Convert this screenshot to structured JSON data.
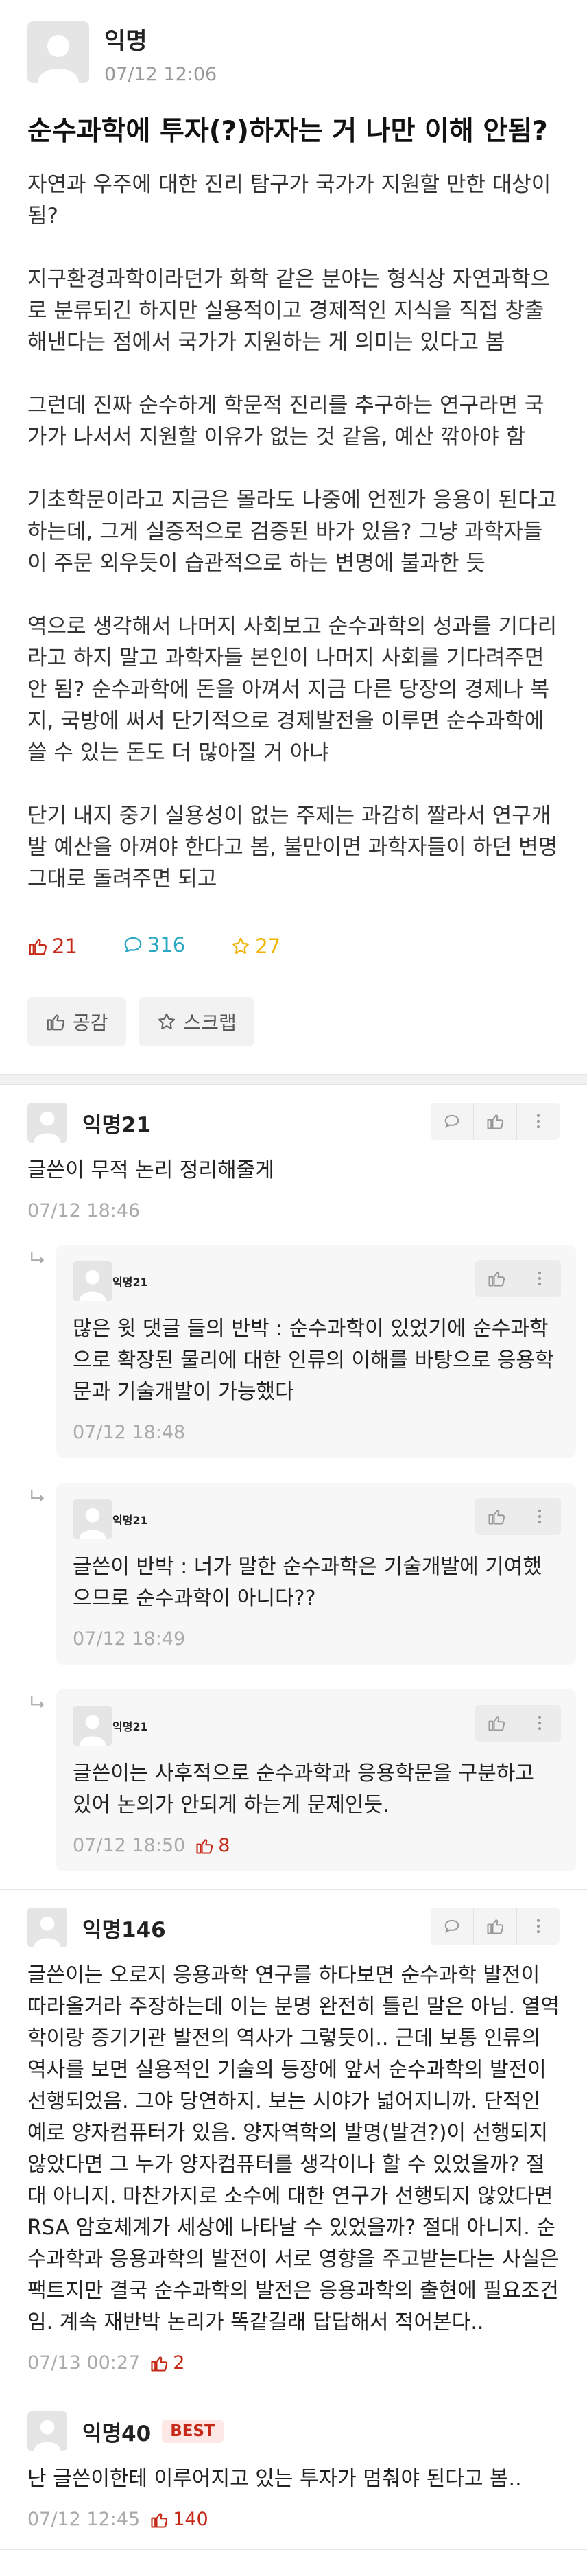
{
  "post": {
    "author": "익명",
    "time": "07/12 12:06",
    "title": "순수과학에 투자(?)하자는 거 나만 이해 안됨?",
    "paragraphs": [
      "자연과 우주에 대한 진리 탐구가 국가가 지원할 만한 대상이 됨?",
      "지구환경과학이라던가 화학 같은 분야는 형식상 자연과학으로 분류되긴 하지만 실용적이고 경제적인 지식을 직접 창출해낸다는 점에서 국가가 지원하는 게 의미는 있다고 봄",
      "그런데 진짜 순수하게 학문적 진리를 추구하는 연구라면 국가가 나서서 지원할 이유가 없는 것 같음, 예산 깎아야 함",
      "기초학문이라고 지금은 몰라도 나중에 언젠가 응용이 된다고 하는데, 그게 실증적으로 검증된 바가 있음? 그냥 과학자들이 주문 외우듯이 습관적으로 하는 변명에 불과한 듯",
      "역으로 생각해서 나머지 사회보고 순수과학의 성과를 기다리라고 하지 말고 과학자들 본인이 나머지 사회를 기다려주면 안 됨? 순수과학에 돈을 아껴서 지금 다른 당장의 경제나 복지, 국방에 써서 단기적으로 경제발전을 이루면 순수과학에 쓸 수 있는 돈도 더 많아질 거 아냐",
      "단기 내지 중기 실용성이 없는 주제는 과감히 짤라서 연구개발 예산을 아껴야 한다고 봄, 불만이면 과학자들이 하던 변명 그대로 돌려주면 되고"
    ],
    "likes": "21",
    "comments": "316",
    "scraps": "27",
    "like_button": "공감",
    "scrap_button": "스크랩"
  },
  "comments": [
    {
      "author": "익명21",
      "text": "글쓴이 무적 논리 정리해줄게",
      "time": "07/12 18:46",
      "likes": "",
      "replies": [
        {
          "author": "익명21",
          "text": "많은 윗 댓글 들의 반박 : 순수과학이 있었기에 순수과학으로 확장된 물리에 대한 인류의 이해를 바탕으로 응용학문과 기술개발이 가능했다",
          "time": "07/12 18:48",
          "likes": ""
        },
        {
          "author": "익명21",
          "text": "글쓴이 반박 : 너가 말한 순수과학은 기술개발에 기여했으므로 순수과학이 아니다??",
          "time": "07/12 18:49",
          "likes": ""
        },
        {
          "author": "익명21",
          "text": "글쓴이는 사후적으로 순수과학과 응용학문을 구분하고 있어 논의가 안되게 하는게 문제인듯.",
          "time": "07/12 18:50",
          "likes": "8"
        }
      ]
    },
    {
      "author": "익명146",
      "text": "글쓴이는 오로지 응용과학 연구를 하다보면 순수과학 발전이 따라올거라 주장하는데 이는 분명 완전히 틀린 말은 아님. 열역학이랑 증기기관 발전의 역사가 그렇듯이.. 근데 보통 인류의 역사를 보면 실용적인 기술의 등장에 앞서 순수과학의 발전이 선행되었음. 그야 당연하지. 보는 시야가 넓어지니까. 단적인 예로 양자컴퓨터가 있음. 양자역학의 발명(발견?)이 선행되지 않았다면 그 누가 양자컴퓨터를 생각이나 할 수 있었을까? 절대 아니지. 마찬가지로 소수에 대한 연구가 선행되지 않았다면 RSA 암호체계가 세상에 나타날 수 있었을까? 절대 아니지. 순수과학과 응용과학의 발전이 서로 영향을 주고받는다는 사실은 팩트지만 결국 순수과학의 발전은 응용과학의 출현에 필요조건임. 계속 재반박 논리가 똑같길래 답답해서 적어본다..",
      "time": "07/13 00:27",
      "likes": "2",
      "replies": []
    },
    {
      "author": "익명40",
      "badge": "BEST",
      "text": "난 글쓴이한테 이루어지고 있는 투자가 멈춰야 된다고 봄..",
      "time": "07/12 12:45",
      "likes": "140",
      "replies": []
    }
  ],
  "colors": {
    "like": "#c62917",
    "comment": "#2aa8c4",
    "scrap": "#f0b400"
  }
}
